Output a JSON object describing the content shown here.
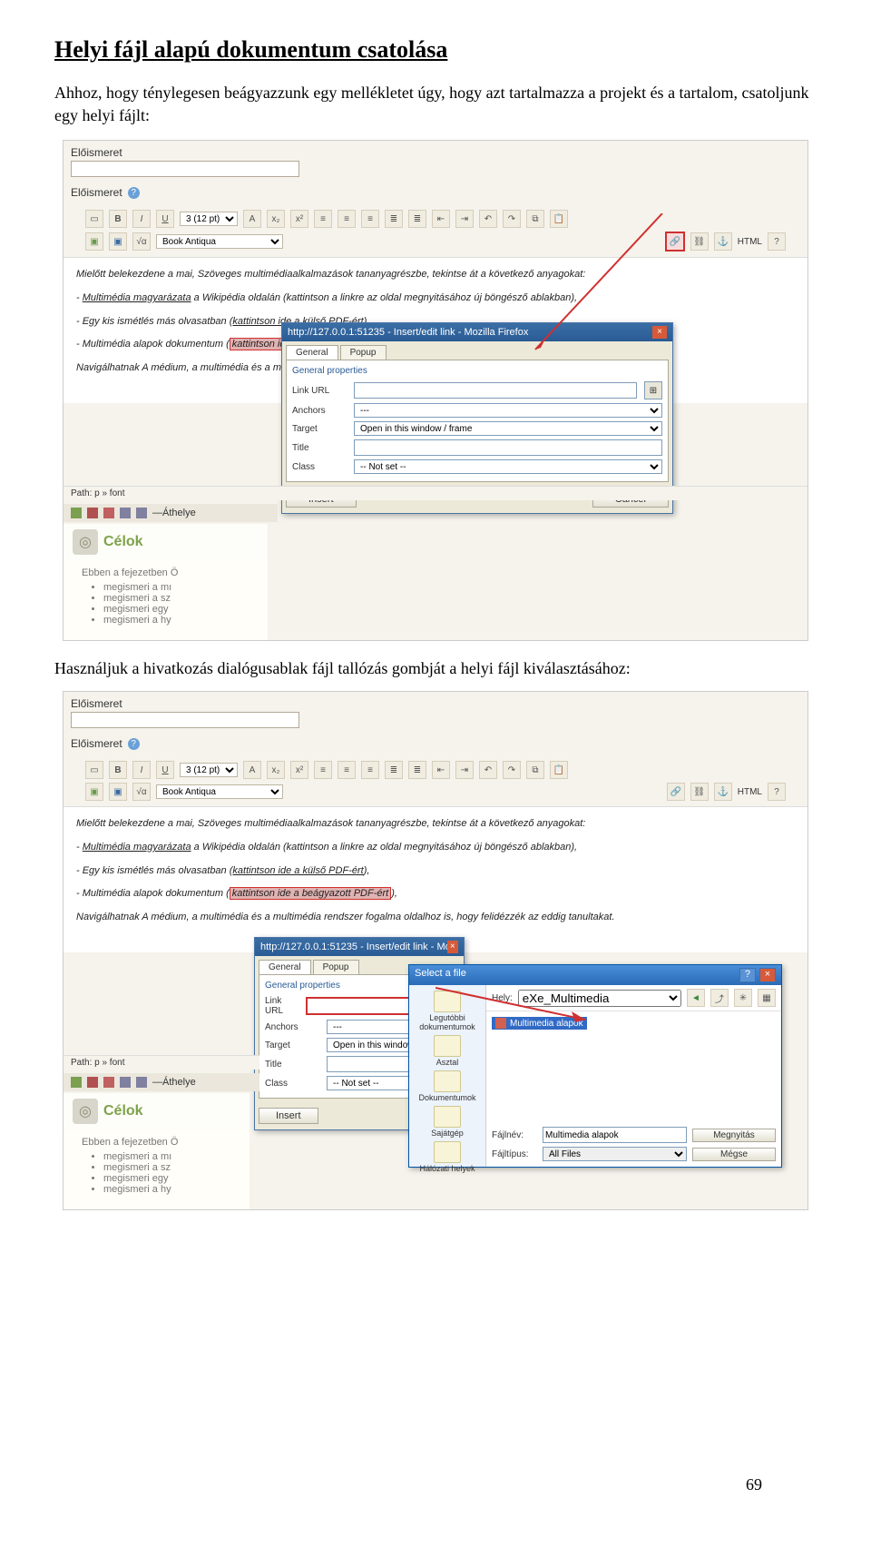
{
  "heading": "Helyi fájl alapú dokumentum csatolása",
  "intro": "Ahhoz, hogy ténylegesen beágyazzunk egy mellékletet úgy, hogy azt tartalmazza a projekt és a tartalom, csatoljunk egy helyi fájlt:",
  "midtext": "Használjuk a hivatkozás dialógusablak fájl tallózás gombját a helyi fájl kiválasztásához:",
  "pagenum": "69",
  "editor": {
    "block_label": "Előismeret",
    "block_label2": "Előismeret",
    "toolbar": {
      "fontsize_label": "3 (12 pt)",
      "fontname_label": "Book Antiqua",
      "html_label": "HTML"
    },
    "content": {
      "line1_a": "Mielőtt belekezdene a mai, ",
      "line1_b": "Szöveges multimédiaalkalmazások",
      "line1_c": " tananyagrészbe, tekintse át a következő anyagokat:",
      "line2_a": "- ",
      "line2_link": "Multimédia magyarázata",
      "line2_b": " a ",
      "line2_i": "Wikipédia",
      "line2_c": " oldalán (kattintson a linkre az oldal megnyitásához új böngésző ablakban),",
      "line3_a": "- Egy kis ismétlés más olvasatban (",
      "line3_link": "kattintson ide a külső PDF-ért",
      "line3_b": "),",
      "line4_a": "- ",
      "line4_i": "Multimédia alapok",
      "line4_b": " dokumentum (",
      "line4_hl": "kattintson ide a beágyazott PDF-ért",
      "line4_c": "),",
      "line5_a": "Navigálhatnak ",
      "line5_i": "A médium, a multimédia és a multimédia rendszer fogalma",
      "line5_b": " oldalhoz is, hogy felidézzék az eddig tanultakat."
    },
    "path_label": "Path: p » font"
  },
  "lowerbar": {
    "text": "—Áthelye"
  },
  "celok": {
    "title": "Célok",
    "intro": "Ebben a fejezetben Ö",
    "items": [
      "megismeri a mı",
      "megismeri a sz",
      "megismeri egy",
      "megismeri a hy"
    ]
  },
  "modal1": {
    "title": "http://127.0.0.1:51235 - Insert/edit link - Mozilla Firefox",
    "tabs": [
      "General",
      "Popup"
    ],
    "fieldset": "General properties",
    "rows": {
      "linkurl": "Link URL",
      "anchors": "Anchors",
      "anchors_val": "---",
      "target": "Target",
      "target_val": "Open in this window / frame",
      "title": "Title",
      "class": "Class",
      "class_val": "-- Not set --"
    },
    "buttons": {
      "insert": "Insert",
      "cancel": "Cancel"
    }
  },
  "modal2": {
    "target_val": "Open in this window"
  },
  "filedlg": {
    "title": "Select a file",
    "hely_label": "Hely:",
    "hely_val": "eXe_Multimedia",
    "selected_file": "Multimedia alapok",
    "places": [
      "Legutóbbi dokumentumok",
      "Asztal",
      "Dokumentumok",
      "Sajátgép",
      "Hálózati helyek"
    ],
    "filename_label": "Fájlnév:",
    "filename_val": "Multimedia alapok",
    "filetype_label": "Fájltípus:",
    "filetype_val": "All Files",
    "open_btn": "Megnyitás",
    "cancel_btn": "Mégse"
  }
}
